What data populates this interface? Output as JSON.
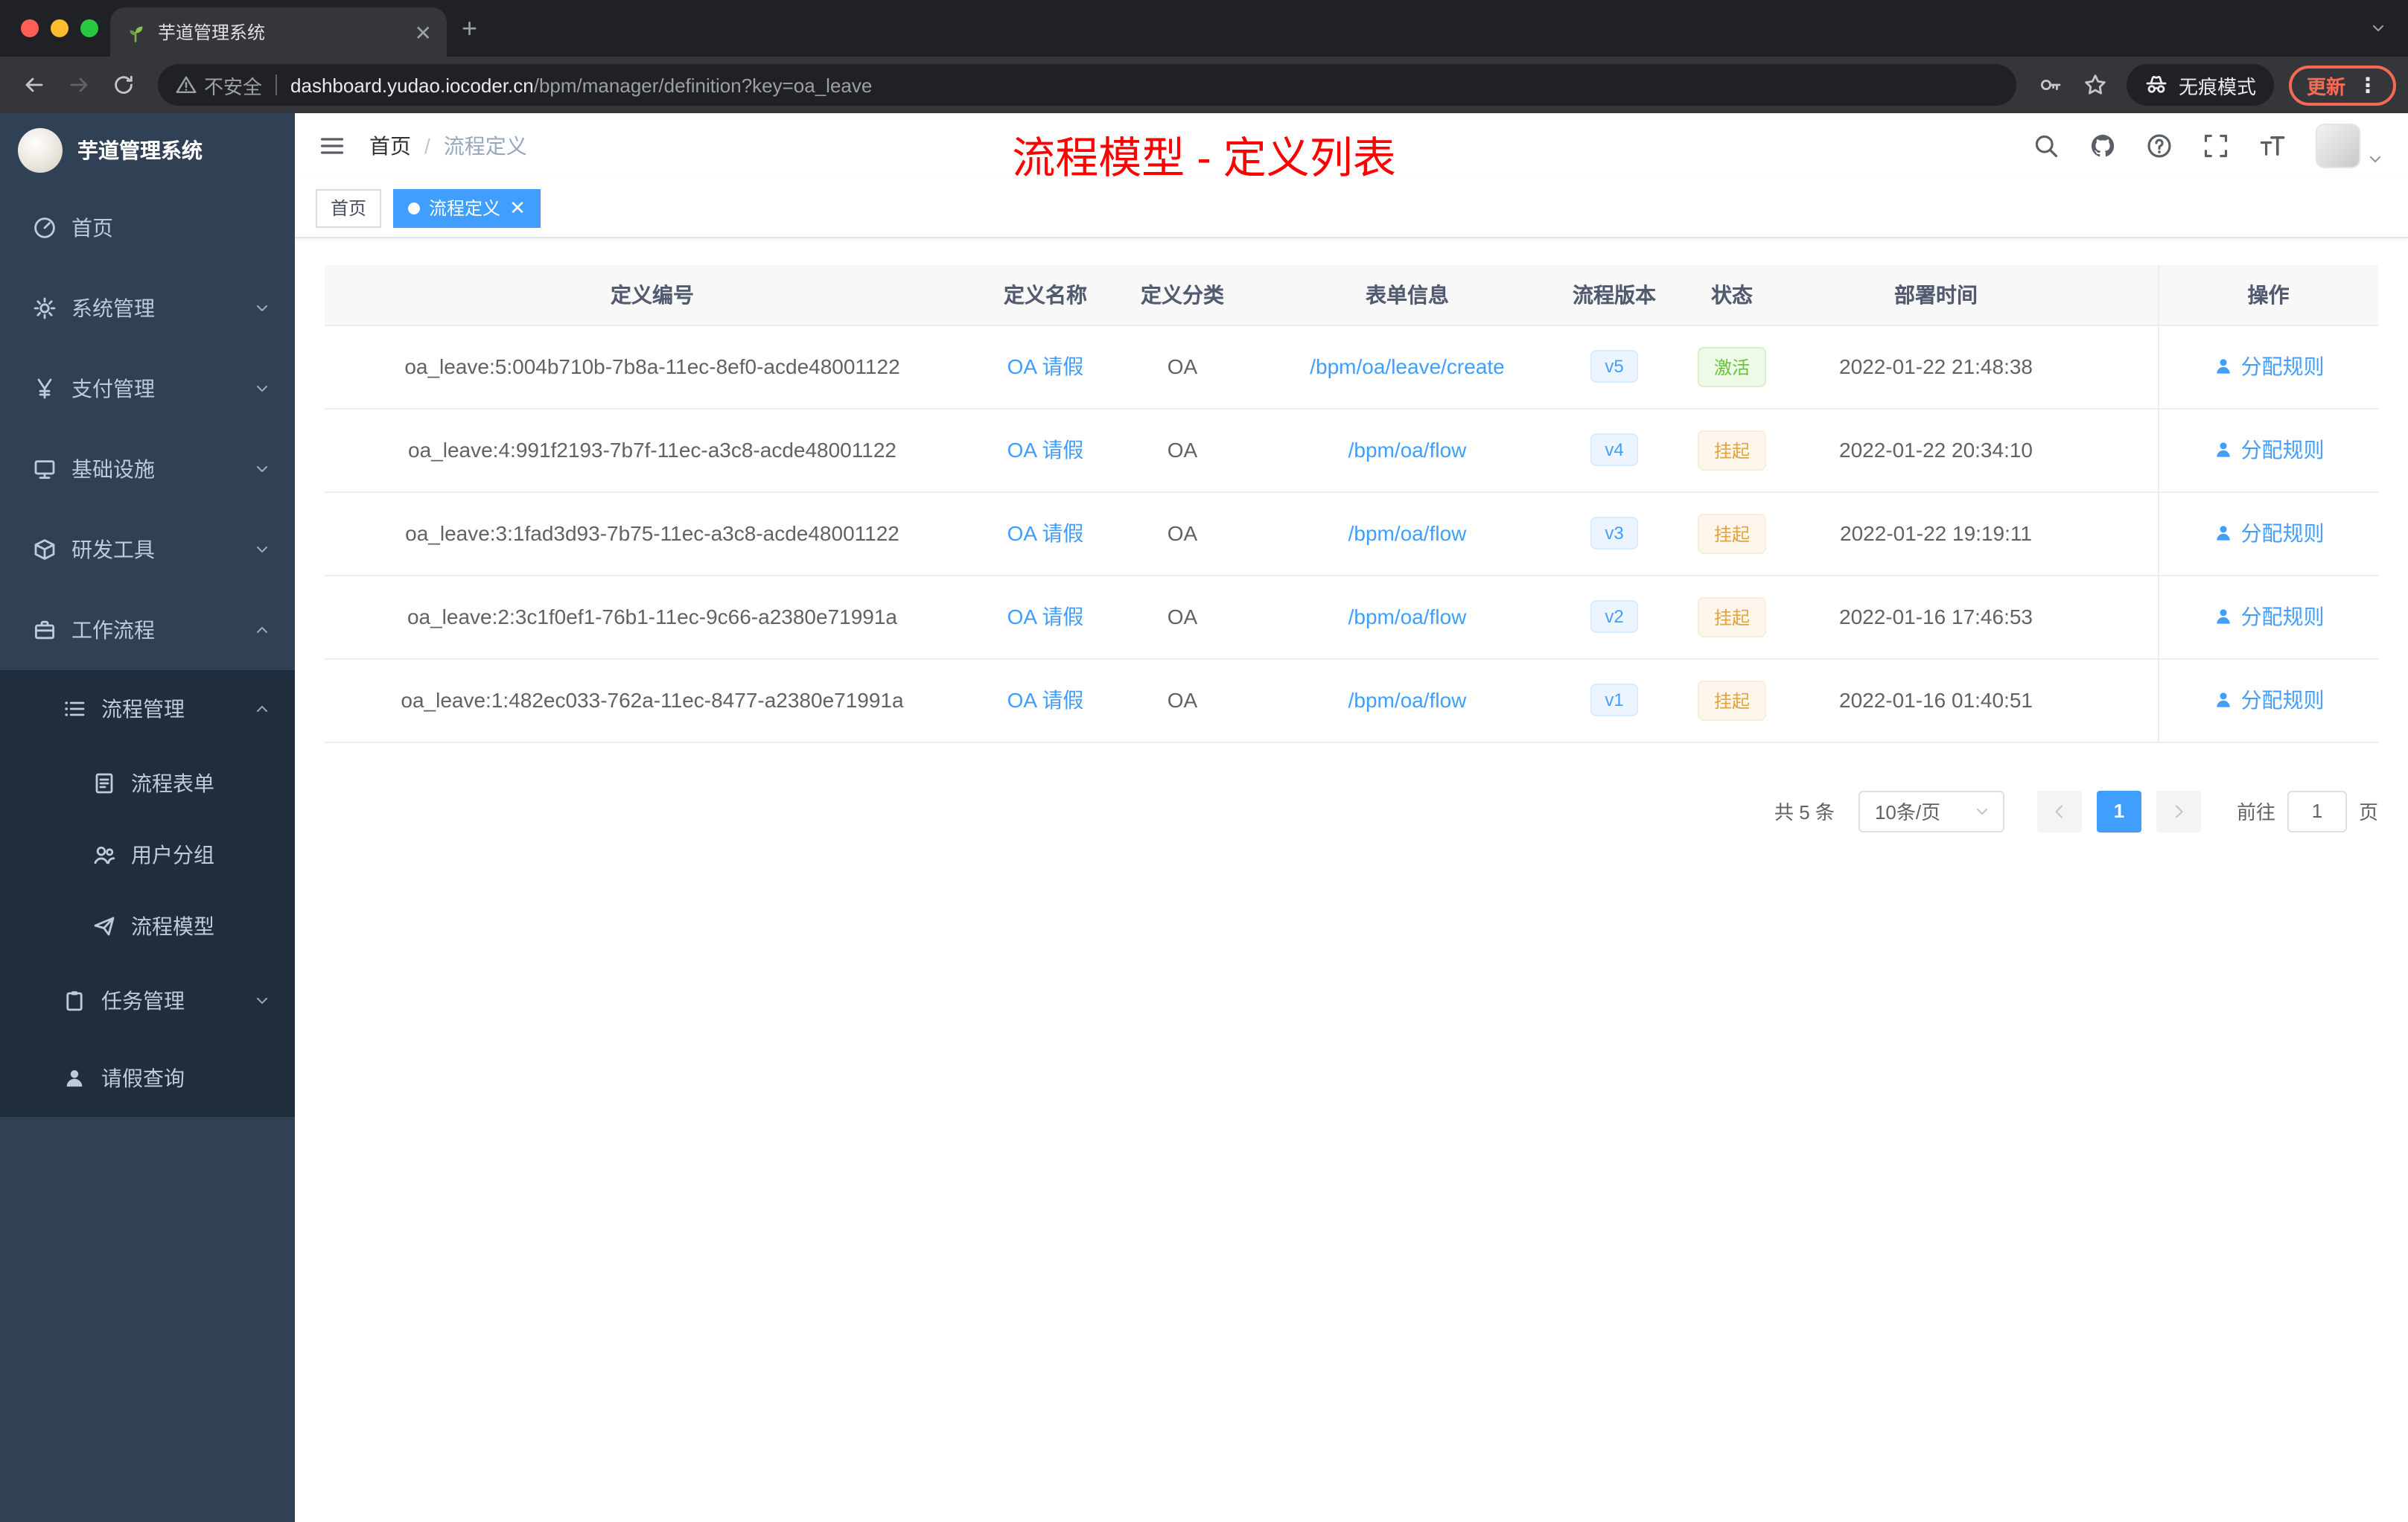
{
  "colors": {
    "accent": "#409eff",
    "success": "#67c23a",
    "warning": "#e6a23c",
    "title_red": "#ff0000",
    "sidebar_bg": "#304156",
    "submenu_bg": "#1f2d3d"
  },
  "browser": {
    "tab_title": "芋道管理系统",
    "security_label": "不安全",
    "url_host": "dashboard.yudao.iocoder.cn",
    "url_path": "/bpm/manager/definition?key=oa_leave",
    "incognito_label": "无痕模式",
    "update_label": "更新"
  },
  "sidebar": {
    "logo_title": "芋道管理系统",
    "items": [
      {
        "label": "首页",
        "icon": "dashboard-icon"
      },
      {
        "label": "系统管理",
        "icon": "gear-icon"
      },
      {
        "label": "支付管理",
        "icon": "yen-icon"
      },
      {
        "label": "基础设施",
        "icon": "monitor-icon"
      },
      {
        "label": "研发工具",
        "icon": "cube-icon"
      },
      {
        "label": "工作流程",
        "icon": "briefcase-icon"
      },
      {
        "label": "流程管理",
        "icon": "list-icon"
      },
      {
        "label": "流程表单",
        "icon": "form-icon"
      },
      {
        "label": "用户分组",
        "icon": "users-icon"
      },
      {
        "label": "流程模型",
        "icon": "paper-plane-icon"
      },
      {
        "label": "任务管理",
        "icon": "clipboard-icon"
      },
      {
        "label": "请假查询",
        "icon": "user-icon"
      }
    ]
  },
  "header": {
    "breadcrumb_home": "首页",
    "breadcrumb_separator": "/",
    "breadcrumb_current": "流程定义",
    "page_title": "流程模型 - 定义列表"
  },
  "tags": {
    "home": "首页",
    "active": "流程定义"
  },
  "table": {
    "columns": [
      "定义编号",
      "定义名称",
      "定义分类",
      "表单信息",
      "流程版本",
      "状态",
      "部署时间",
      "操作"
    ],
    "rows": [
      {
        "id": "oa_leave:5:004b710b-7b8a-11ec-8ef0-acde48001122",
        "name": "OA 请假",
        "category": "OA",
        "form": "/bpm/oa/leave/create",
        "version": "v5",
        "status": "激活",
        "status_type": "active",
        "deployed": "2022-01-22 21:48:38",
        "action": "分配规则"
      },
      {
        "id": "oa_leave:4:991f2193-7b7f-11ec-a3c8-acde48001122",
        "name": "OA 请假",
        "category": "OA",
        "form": "/bpm/oa/flow",
        "version": "v4",
        "status": "挂起",
        "status_type": "suspended",
        "deployed": "2022-01-22 20:34:10",
        "action": "分配规则"
      },
      {
        "id": "oa_leave:3:1fad3d93-7b75-11ec-a3c8-acde48001122",
        "name": "OA 请假",
        "category": "OA",
        "form": "/bpm/oa/flow",
        "version": "v3",
        "status": "挂起",
        "status_type": "suspended",
        "deployed": "2022-01-22 19:19:11",
        "action": "分配规则"
      },
      {
        "id": "oa_leave:2:3c1f0ef1-76b1-11ec-9c66-a2380e71991a",
        "name": "OA 请假",
        "category": "OA",
        "form": "/bpm/oa/flow",
        "version": "v2",
        "status": "挂起",
        "status_type": "suspended",
        "deployed": "2022-01-16 17:46:53",
        "action": "分配规则"
      },
      {
        "id": "oa_leave:1:482ec033-762a-11ec-8477-a2380e71991a",
        "name": "OA 请假",
        "category": "OA",
        "form": "/bpm/oa/flow",
        "version": "v1",
        "status": "挂起",
        "status_type": "suspended",
        "deployed": "2022-01-16 01:40:51",
        "action": "分配规则"
      }
    ]
  },
  "pagination": {
    "total": "共 5 条",
    "page_size": "10条/页",
    "current_page": "1",
    "goto_label": "前往",
    "goto_value": "1",
    "unit_label": "页"
  }
}
